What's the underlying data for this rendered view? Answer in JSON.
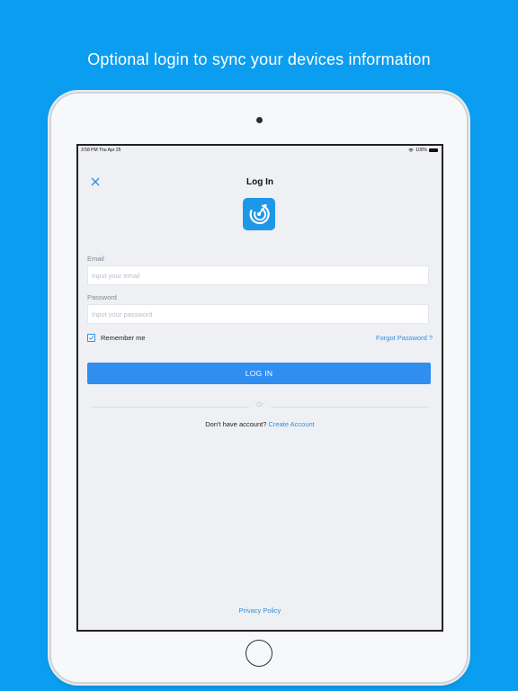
{
  "promo": {
    "headline": "Optional login to sync your devices information"
  },
  "status_bar": {
    "time_date": "3:58 PM   Thu Apr 25",
    "battery": "100%"
  },
  "nav": {
    "title": "Log In"
  },
  "form": {
    "email_label": "Email",
    "email_placeholder": "Input your email",
    "email_value": "",
    "password_label": "Password",
    "password_placeholder": "Input your password",
    "password_value": "",
    "remember_label": "Remember me",
    "remember_checked": true,
    "forgot_label": "Forgot Password ?",
    "login_label": "LOG IN"
  },
  "divider": {
    "text": "Or"
  },
  "signup": {
    "prompt": "Don't have account?",
    "link": "Create Account"
  },
  "footer": {
    "privacy": "Privacy Policy"
  },
  "colors": {
    "background": "#0b9ef0",
    "accent": "#2f8ef0",
    "link": "#2c8fe0",
    "logo_bg": "#1d97e8"
  },
  "icons": [
    "close-icon",
    "radar-logo-icon",
    "checkmark-icon",
    "wifi-icon",
    "battery-icon"
  ]
}
